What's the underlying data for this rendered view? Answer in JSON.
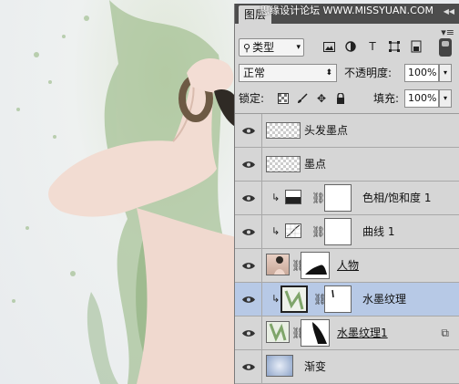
{
  "watermark": "思缘设计论坛 WWW.MISSYUAN.COM",
  "panel": {
    "tab": "图层",
    "menu_icon": "panel-menu-icon",
    "filter": {
      "label": "类型",
      "icon": "search-icon"
    },
    "filter_icons": [
      "image-filter-icon",
      "adjustment-filter-icon",
      "type-filter-icon",
      "shape-filter-icon",
      "smart-object-filter-icon"
    ],
    "blend_mode": "正常",
    "opacity_label": "不透明度:",
    "opacity_value": "100%",
    "lock_label": "锁定:",
    "lock_icons": [
      "lock-transparent-icon",
      "lock-paint-icon",
      "lock-move-icon",
      "lock-all-icon"
    ],
    "fill_label": "填充:",
    "fill_value": "100%"
  },
  "layers": [
    {
      "name": "头发墨点",
      "thumb": "transparent-wide",
      "visible": true,
      "clipped": false,
      "mask": false,
      "selected": false
    },
    {
      "name": "墨点",
      "thumb": "transparent-wide",
      "visible": true,
      "clipped": false,
      "mask": false,
      "selected": false
    },
    {
      "name": "色相/饱和度 1",
      "thumb": "adjustment-hue-saturation",
      "visible": true,
      "clipped": true,
      "mask": true,
      "selected": false
    },
    {
      "name": "曲线 1",
      "thumb": "adjustment-curves",
      "visible": true,
      "clipped": true,
      "mask": true,
      "selected": false
    },
    {
      "name": "人物",
      "thumb": "photo-person",
      "visible": true,
      "clipped": false,
      "mask": true,
      "selected": false,
      "smart_object": true
    },
    {
      "name": "水墨纹理",
      "thumb": "ink-texture",
      "visible": true,
      "clipped": true,
      "mask": true,
      "selected": true
    },
    {
      "name": "水墨纹理1",
      "thumb": "ink-texture",
      "visible": true,
      "clipped": false,
      "mask": true,
      "selected": false,
      "smart_object": true,
      "has_badge": true
    },
    {
      "name": "渐变",
      "thumb": "gradient",
      "visible": true,
      "clipped": false,
      "mask": false,
      "selected": false
    }
  ],
  "colors": {
    "selected_row": "#b7c9e6",
    "panel_bg": "#d6d6d6",
    "tabbar_bg": "#4d4d4d"
  }
}
